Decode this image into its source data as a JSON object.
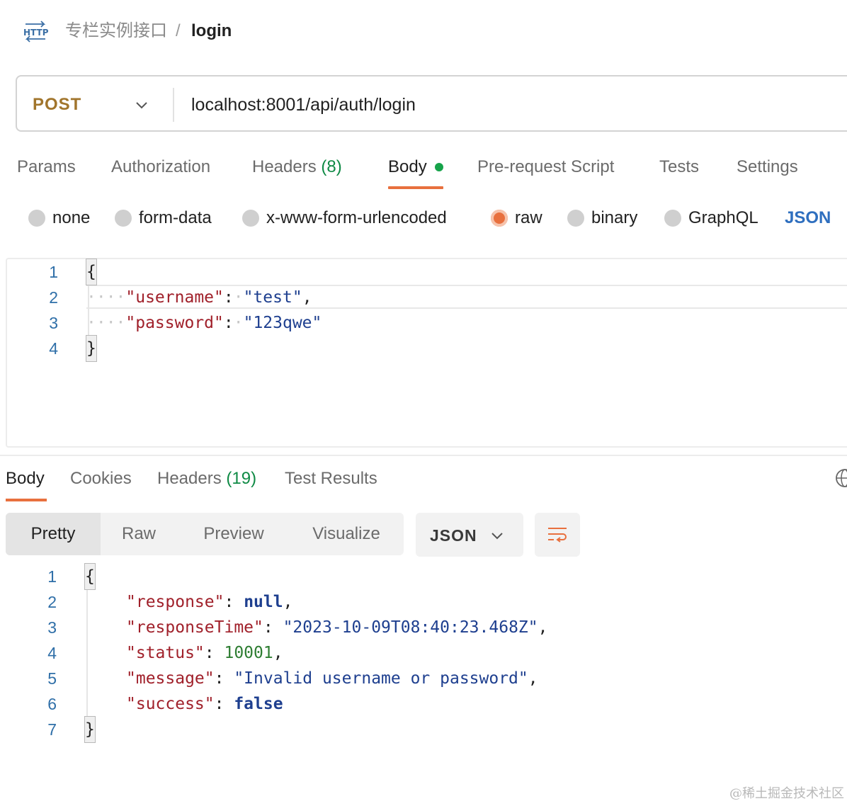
{
  "breadcrumb": {
    "parent": "专栏实例接口",
    "separator": "/",
    "current": "login"
  },
  "request": {
    "method": "POST",
    "url": "localhost:8001/api/auth/login",
    "tabs": [
      {
        "label": "Params",
        "count": ""
      },
      {
        "label": "Authorization",
        "count": ""
      },
      {
        "label": "Headers",
        "count": "(8)"
      },
      {
        "label": "Body",
        "count": ""
      },
      {
        "label": "Pre-request Script",
        "count": ""
      },
      {
        "label": "Tests",
        "count": ""
      },
      {
        "label": "Settings",
        "count": ""
      }
    ],
    "active_tab": "Body",
    "body_types": [
      "none",
      "form-data",
      "x-www-form-urlencoded",
      "raw",
      "binary",
      "GraphQL"
    ],
    "selected_body_type": "raw",
    "raw_format": "JSON",
    "editor": {
      "line_numbers": [
        "1",
        "2",
        "3",
        "4"
      ],
      "open_brace": "{",
      "close_brace": "}",
      "fields": [
        {
          "key": "\"username\"",
          "value": "\"test\"",
          "trail": ","
        },
        {
          "key": "\"password\"",
          "value": "\"123qwe\"",
          "trail": ""
        }
      ]
    }
  },
  "response": {
    "tabs": [
      {
        "label": "Body",
        "count": ""
      },
      {
        "label": "Cookies",
        "count": ""
      },
      {
        "label": "Headers",
        "count": "(19)"
      },
      {
        "label": "Test Results",
        "count": ""
      }
    ],
    "active_tab": "Body",
    "view_modes": [
      "Pretty",
      "Raw",
      "Preview",
      "Visualize"
    ],
    "active_view": "Pretty",
    "format": "JSON",
    "line_numbers": [
      "1",
      "2",
      "3",
      "4",
      "5",
      "6",
      "7"
    ],
    "open_brace": "{",
    "close_brace": "}",
    "fields": [
      {
        "key": "\"response\"",
        "value": "null",
        "type": "keyword",
        "trail": ","
      },
      {
        "key": "\"responseTime\"",
        "value": "\"2023-10-09T08:40:23.468Z\"",
        "type": "string",
        "trail": ","
      },
      {
        "key": "\"status\"",
        "value": "10001",
        "type": "number",
        "trail": ","
      },
      {
        "key": "\"message\"",
        "value": "\"Invalid username or password\"",
        "type": "string",
        "trail": ","
      },
      {
        "key": "\"success\"",
        "value": "false",
        "type": "keyword",
        "trail": ""
      }
    ]
  },
  "colors": {
    "accent": "#e8703e",
    "method": "#a1752c",
    "count": "#0f8a45",
    "json_key": "#a0202a",
    "json_string": "#1e3f8f",
    "json_number": "#2e7d32"
  },
  "watermark": "@稀土掘金技术社区"
}
